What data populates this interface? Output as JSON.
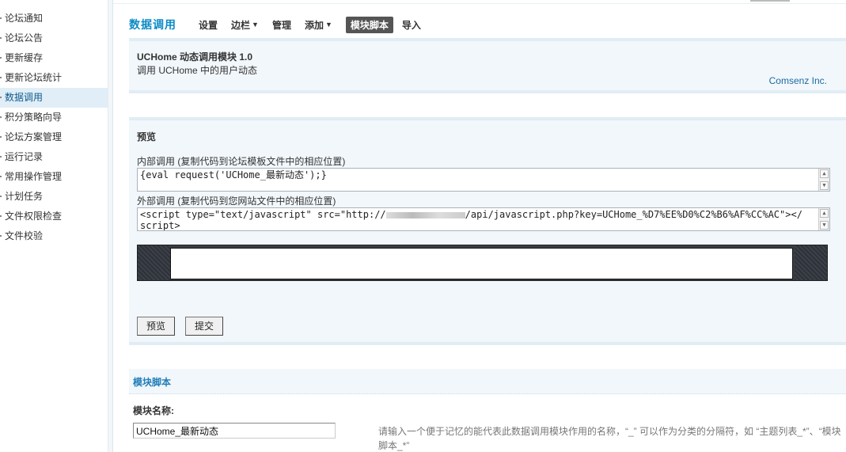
{
  "sidebar": {
    "items": [
      {
        "label": "论坛通知",
        "active": false
      },
      {
        "label": "论坛公告",
        "active": false
      },
      {
        "label": "更新缓存",
        "active": false
      },
      {
        "label": "更新论坛统计",
        "active": false
      },
      {
        "label": "数据调用",
        "active": true
      },
      {
        "label": "积分策略向导",
        "active": false
      },
      {
        "label": "论坛方案管理",
        "active": false
      },
      {
        "label": "运行记录",
        "active": false
      },
      {
        "label": "常用操作管理",
        "active": false
      },
      {
        "label": "计划任务",
        "active": false
      },
      {
        "label": "文件权限检查",
        "active": false
      },
      {
        "label": "文件校验",
        "active": false
      }
    ]
  },
  "header": {
    "title": "数据调用",
    "nav": [
      {
        "label": "设置",
        "dropdown": false,
        "current": false
      },
      {
        "label": "边栏",
        "dropdown": true,
        "current": false
      },
      {
        "label": "管理",
        "dropdown": false,
        "current": false
      },
      {
        "label": "添加",
        "dropdown": true,
        "current": false
      },
      {
        "label": "模块脚本",
        "dropdown": false,
        "current": true
      },
      {
        "label": "导入",
        "dropdown": false,
        "current": false
      }
    ]
  },
  "module": {
    "name": "UCHome 动态调用模块  1.0",
    "description": "调用  UCHome 中的用户动态",
    "vendor": "Comsenz Inc."
  },
  "preview": {
    "title": "预览",
    "internal_label": "内部调用 (复制代码到论坛模板文件中的相应位置)",
    "internal_code": "{eval request('UCHome_最新动态');}",
    "external_label": "外部调用 (复制代码到您网站文件中的相应位置)",
    "external_code_prefix": "<script type=\"text/javascript\" src=\"http://",
    "external_code_suffix": "/api/javascript.php?key=UCHome_%D7%EE%D0%C2%B6%AF%CC%AC\"></",
    "external_code_line2": "script>",
    "preview_button": "预览",
    "submit_button": "提交"
  },
  "script_section": {
    "title": "模块脚本",
    "name_label": "模块名称:",
    "name_value": "UCHome_最新动态",
    "name_hint": "请输入一个便于记忆的能代表此数据调用模块作用的名称，“_” 可以作为分类的分隔符，如 “主题列表_*”、“模块脚本_*”"
  }
}
